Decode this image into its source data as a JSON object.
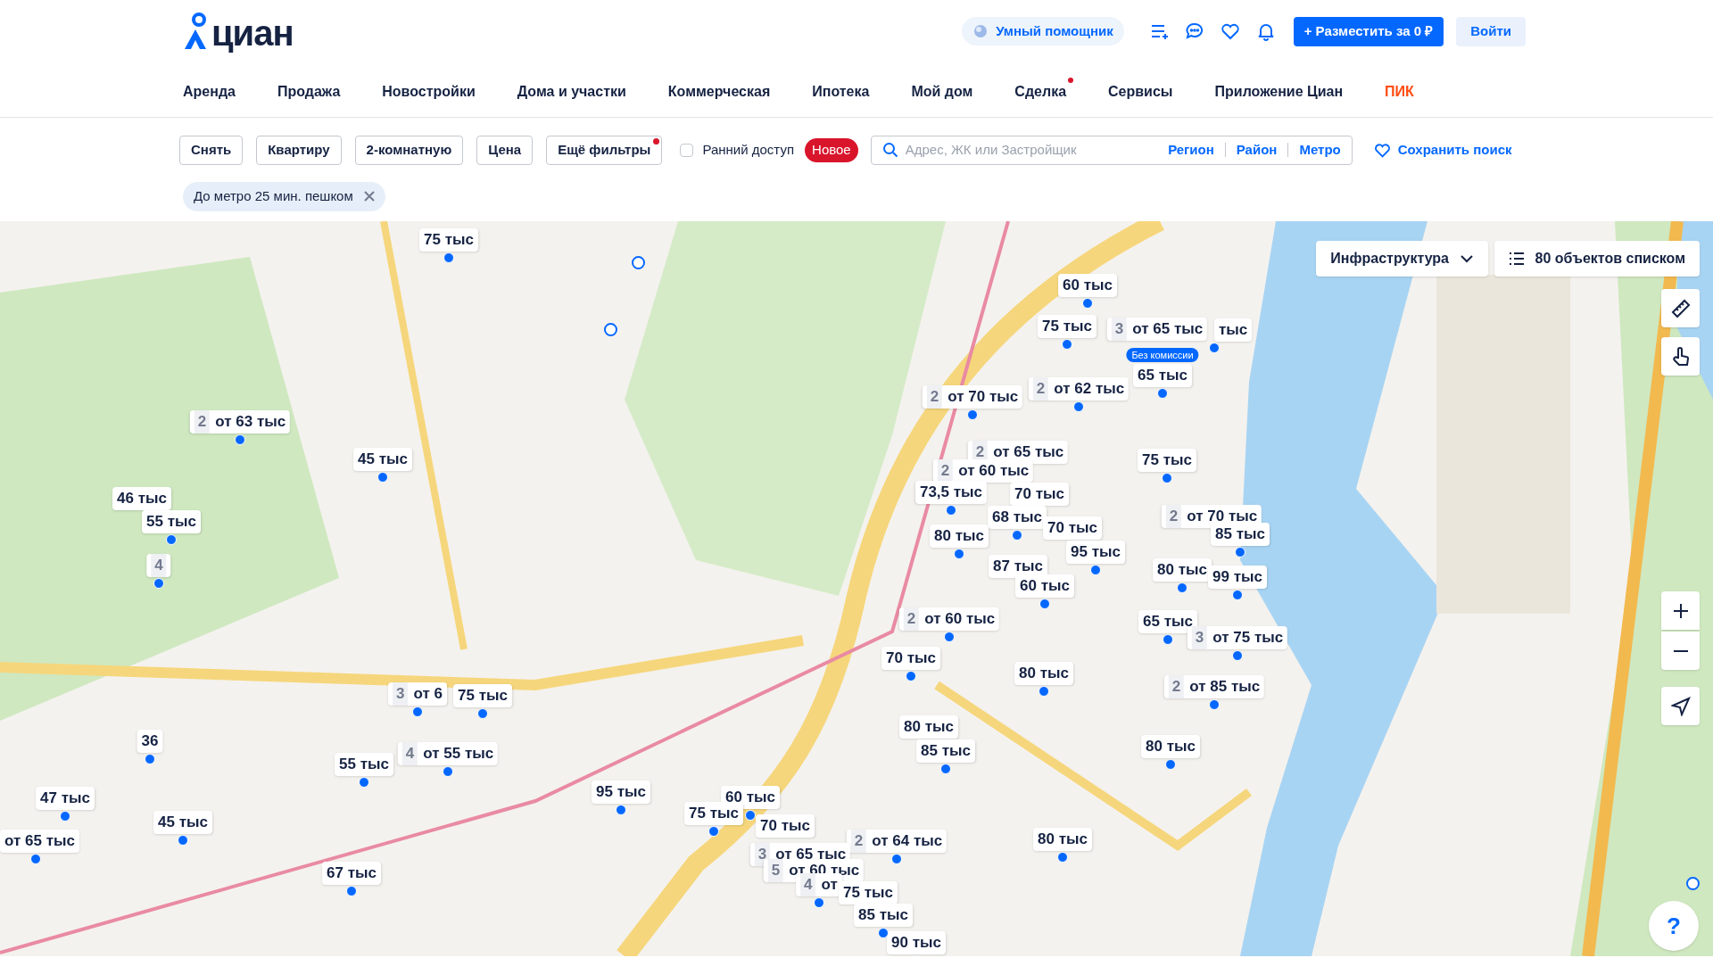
{
  "header": {
    "logo": "циан",
    "assistant": "Умный помощник",
    "post_button": "+ Разместить за 0 ₽",
    "login": "Войти"
  },
  "nav": [
    {
      "label": "Аренда",
      "kind": "link",
      "dot": false
    },
    {
      "label": "Продажа",
      "kind": "link",
      "dot": false
    },
    {
      "label": "Новостройки",
      "kind": "link",
      "dot": false
    },
    {
      "label": "Дома и участки",
      "kind": "link",
      "dot": false
    },
    {
      "label": "Коммерческая",
      "kind": "link",
      "dot": false
    },
    {
      "label": "Ипотека",
      "kind": "link",
      "dot": false
    },
    {
      "label": "Мой дом",
      "kind": "link",
      "dot": false
    },
    {
      "label": "Сделка",
      "kind": "link",
      "dot": true
    },
    {
      "label": "Сервисы",
      "kind": "link",
      "dot": false
    },
    {
      "label": "Приложение Циан",
      "kind": "link",
      "dot": false
    },
    {
      "label": "ПИК",
      "kind": "brand",
      "dot": false
    }
  ],
  "filters": [
    {
      "label": "Снять",
      "dot": false
    },
    {
      "label": "Квартиру",
      "dot": false
    },
    {
      "label": "2-комнатную",
      "dot": false
    },
    {
      "label": "Цена",
      "dot": false
    },
    {
      "label": "Ещё фильтры",
      "dot": true
    }
  ],
  "early_access": {
    "label": "Ранний доступ",
    "checked": false,
    "badge": "Новое"
  },
  "search": {
    "placeholder": "Адрес, ЖК или Застройщик",
    "links": [
      "Регион",
      "Район",
      "Метро"
    ]
  },
  "save_search": "Сохранить поиск",
  "chips": [
    {
      "label": "До метро 25 мин. пешком"
    }
  ],
  "map": {
    "infrastructure": "Инфраструктура",
    "list_button": "80 объектов списком",
    "help": "?",
    "pins": [
      {
        "price": "75 тыс"
      },
      {
        "count": "2",
        "price": "от 63 тыс"
      },
      {
        "price": "45 тыс"
      },
      {
        "price": "46 тыс"
      },
      {
        "price": "55 тыс"
      },
      {
        "count": "4"
      },
      {
        "price": "60 тыс"
      },
      {
        "price": "75 тыс"
      },
      {
        "count": "3",
        "price": "от 65 тыс"
      },
      {
        "price": "тыс"
      },
      {
        "price": "65 тыс",
        "badge": "Без комиссии"
      },
      {
        "count": "2",
        "price": "от 62 тыс"
      },
      {
        "count": "2",
        "price": "от 70 тыс"
      },
      {
        "count": "2",
        "price": "от 65 тыс"
      },
      {
        "count": "2",
        "price": "от 60 тыс"
      },
      {
        "price": "75 тыс"
      },
      {
        "price": "73,5 тыс"
      },
      {
        "price": "70 тыс"
      },
      {
        "price": "68 тыс"
      },
      {
        "price": "80 тыс"
      },
      {
        "price": "70 тыс"
      },
      {
        "count": "2",
        "price": "от 70 тыс"
      },
      {
        "price": "85 тыс"
      },
      {
        "price": "95 тыс"
      },
      {
        "price": "87 тыс"
      },
      {
        "price": "80 тыс"
      },
      {
        "price": "99 тыс"
      },
      {
        "price": "60 тыс"
      },
      {
        "count": "2",
        "price": "от 60 тыс"
      },
      {
        "price": "65 тыс"
      },
      {
        "count": "3",
        "price": "от 75 тыс"
      },
      {
        "price": "70 тыс"
      },
      {
        "price": "80 тыс"
      },
      {
        "count": "2",
        "price": "от 85 тыс"
      },
      {
        "price": "80 тыс"
      },
      {
        "price": "85 тыс"
      },
      {
        "price": "80 тыс"
      },
      {
        "count": "2",
        "price": "от 64 тыс"
      },
      {
        "price": "80 тыс"
      },
      {
        "price": "90 тыс"
      },
      {
        "count": "3",
        "price": "от 6"
      },
      {
        "price": "75 тыс"
      },
      {
        "price": "36"
      },
      {
        "count": "4",
        "price": "от 55 тыс"
      },
      {
        "price": "55 тыс"
      },
      {
        "price": "47 тыс"
      },
      {
        "price": "45 тыс"
      },
      {
        "price": "от 65 тыс"
      },
      {
        "price": "67 тыс"
      },
      {
        "price": "95 тыс"
      },
      {
        "price": "60 тыс"
      },
      {
        "price": "75 тыс"
      },
      {
        "price": "70 тыс"
      },
      {
        "count": "3",
        "price": "от 65 тыс"
      },
      {
        "count": "5",
        "price": "от 60 тыс"
      },
      {
        "count": "4",
        "price": "от"
      },
      {
        "price": "75 тыс"
      },
      {
        "price": "85 тыс"
      }
    ]
  }
}
